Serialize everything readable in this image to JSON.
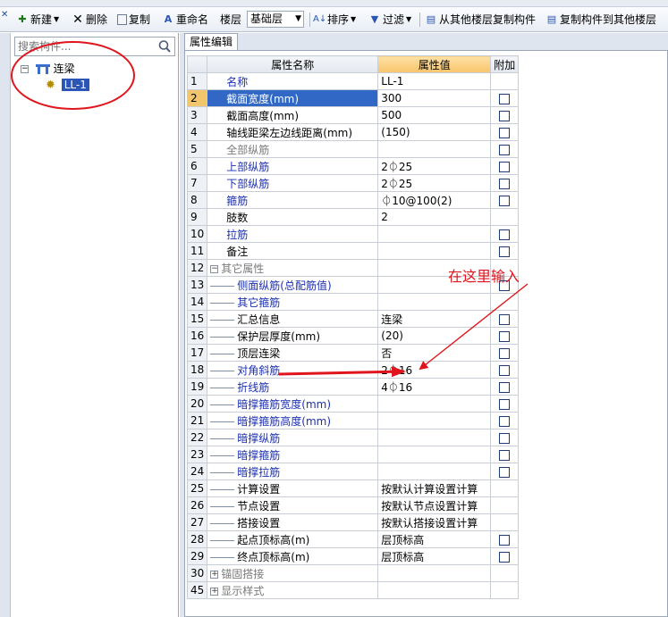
{
  "toolbar": {
    "new_label": "新建",
    "delete_label": "删除",
    "copy_label": "复制",
    "rename_label": "重命名",
    "floor_label": "楼层",
    "floor_value": "基础层",
    "sort_label": "排序",
    "filter_label": "过滤",
    "copy_from_floor_label": "从其他楼层复制构件",
    "copy_to_floor_label": "复制构件到其他楼层"
  },
  "left_panel": {
    "search_placeholder": "搜索构件...",
    "tree": {
      "root_label": "连梁",
      "child_label": "LL-1"
    }
  },
  "tab": {
    "label": "属性编辑"
  },
  "grid": {
    "headers": {
      "name": "属性名称",
      "value": "属性值",
      "add": "附加"
    },
    "rows": [
      {
        "num": "1",
        "name": "名称",
        "value": "LL-1"
      },
      {
        "num": "2",
        "name": "截面宽度(mm)",
        "value": "300"
      },
      {
        "num": "3",
        "name": "截面高度(mm)",
        "value": "500"
      },
      {
        "num": "4",
        "name": "轴线距梁左边线距离(mm)",
        "value": "(150)"
      },
      {
        "num": "5",
        "name": "全部纵筋",
        "value": ""
      },
      {
        "num": "6",
        "name": "上部纵筋",
        "value": "2⏀25"
      },
      {
        "num": "7",
        "name": "下部纵筋",
        "value": "2⏀25"
      },
      {
        "num": "8",
        "name": "箍筋",
        "value": "⏀10@100(2)"
      },
      {
        "num": "9",
        "name": "肢数",
        "value": "2"
      },
      {
        "num": "10",
        "name": "拉筋",
        "value": ""
      },
      {
        "num": "11",
        "name": "备注",
        "value": ""
      },
      {
        "num": "12",
        "name": "其它属性",
        "value": ""
      },
      {
        "num": "13",
        "name": "侧面纵筋(总配筋值)",
        "value": ""
      },
      {
        "num": "14",
        "name": "其它箍筋",
        "value": ""
      },
      {
        "num": "15",
        "name": "汇总信息",
        "value": "连梁"
      },
      {
        "num": "16",
        "name": "保护层厚度(mm)",
        "value": "(20)"
      },
      {
        "num": "17",
        "name": "顶层连梁",
        "value": "否"
      },
      {
        "num": "18",
        "name": "对角斜筋",
        "value": "2⏀16"
      },
      {
        "num": "19",
        "name": "折线筋",
        "value": "4⏀16"
      },
      {
        "num": "20",
        "name": "暗撑箍筋宽度(mm)",
        "value": ""
      },
      {
        "num": "21",
        "name": "暗撑箍筋高度(mm)",
        "value": ""
      },
      {
        "num": "22",
        "name": "暗撑纵筋",
        "value": ""
      },
      {
        "num": "23",
        "name": "暗撑箍筋",
        "value": ""
      },
      {
        "num": "24",
        "name": "暗撑拉筋",
        "value": ""
      },
      {
        "num": "25",
        "name": "计算设置",
        "value": "按默认计算设置计算"
      },
      {
        "num": "26",
        "name": "节点设置",
        "value": "按默认节点设置计算"
      },
      {
        "num": "27",
        "name": "搭接设置",
        "value": "按默认搭接设置计算"
      },
      {
        "num": "28",
        "name": "起点顶标高(m)",
        "value": "层顶标高"
      },
      {
        "num": "29",
        "name": "终点顶标高(m)",
        "value": "层顶标高"
      },
      {
        "num": "30",
        "name": "锚固搭接",
        "value": ""
      },
      {
        "num": "45",
        "name": "显示样式",
        "value": ""
      }
    ]
  },
  "annotation": {
    "text": "在这里输入"
  },
  "colors": {
    "annotation_red": "#e0141c",
    "selection_blue": "#3168c6",
    "header_orange": "#f7c46a",
    "blue_text": "#1b2fb0"
  }
}
